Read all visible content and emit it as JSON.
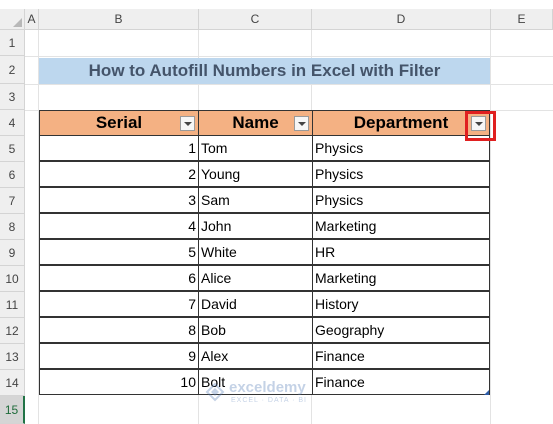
{
  "columns": [
    "A",
    "B",
    "C",
    "D",
    "E"
  ],
  "rows": [
    "1",
    "2",
    "3",
    "4",
    "5",
    "6",
    "7",
    "8",
    "9",
    "10",
    "11",
    "12",
    "13",
    "14",
    "15"
  ],
  "title": "How to Autofill Numbers in Excel with Filter",
  "table": {
    "headers": [
      "Serial",
      "Name",
      "Department"
    ],
    "rows": [
      {
        "serial": "1",
        "name": "Tom",
        "department": "Physics"
      },
      {
        "serial": "2",
        "name": "Young",
        "department": "Physics"
      },
      {
        "serial": "3",
        "name": "Sam",
        "department": "Physics"
      },
      {
        "serial": "4",
        "name": "John",
        "department": "Marketing"
      },
      {
        "serial": "5",
        "name": "White",
        "department": "HR"
      },
      {
        "serial": "6",
        "name": "Alice",
        "department": "Marketing"
      },
      {
        "serial": "7",
        "name": "David",
        "department": "History"
      },
      {
        "serial": "8",
        "name": "Bob",
        "department": "Geography"
      },
      {
        "serial": "9",
        "name": "Alex",
        "department": "Finance"
      },
      {
        "serial": "10",
        "name": "Bolt",
        "department": "Finance"
      }
    ]
  },
  "watermark": {
    "name": "exceldemy",
    "tagline": "EXCEL · DATA · BI"
  },
  "colors": {
    "title_bg": "#bdd7ee",
    "header_bg": "#f4b183",
    "highlight": "#e02020",
    "selected_row": "#217346"
  }
}
